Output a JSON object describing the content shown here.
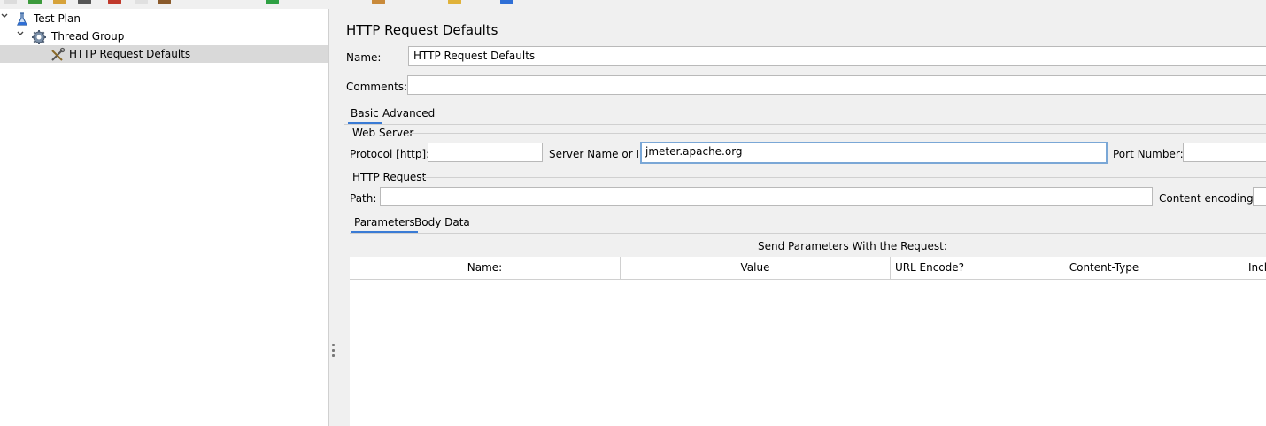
{
  "toolbar": {
    "icons": [
      "new-icon",
      "templates-icon",
      "open-icon",
      "save-icon",
      "cut-icon",
      "copy-icon",
      "paste-icon",
      "start-icon",
      "clear-icon",
      "function-helper-icon",
      "help-icon"
    ]
  },
  "tree": {
    "items": [
      {
        "label": "Test Plan",
        "icon": "flask-icon"
      },
      {
        "label": "Thread Group",
        "icon": "gear-icon"
      },
      {
        "label": "HTTP Request Defaults",
        "icon": "wrench-icon"
      }
    ]
  },
  "panel": {
    "title": "HTTP Request Defaults",
    "name_label": "Name:",
    "name_value": "HTTP Request Defaults",
    "comments_label": "Comments:",
    "comments_value": "",
    "tabs": [
      "Basic",
      "Advanced"
    ],
    "web_server": {
      "section": "Web Server",
      "protocol_label": "Protocol [http]:",
      "protocol_value": "",
      "server_label": "Server Name or IP:",
      "server_value": "jmeter.apache.org",
      "port_label": "Port Number:",
      "port_value": ""
    },
    "http_request": {
      "section": "HTTP Request",
      "path_label": "Path:",
      "path_value": "",
      "encoding_label": "Content encoding:",
      "encoding_value": ""
    },
    "sub_tabs": [
      "Parameters",
      "Body Data"
    ],
    "params": {
      "caption": "Send Parameters With the Request:",
      "columns": [
        "Name:",
        "Value",
        "URL Encode?",
        "Content-Type",
        "Incl"
      ]
    }
  }
}
